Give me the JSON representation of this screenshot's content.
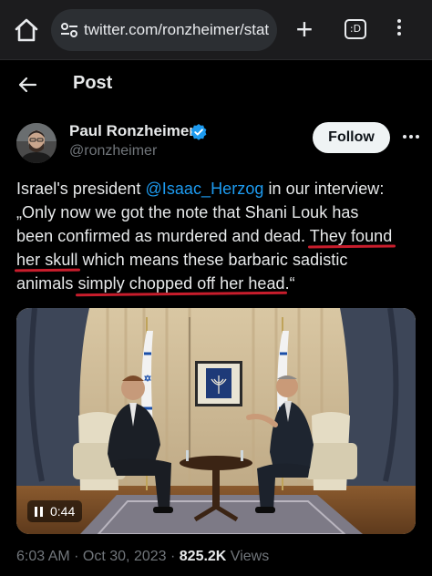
{
  "browser": {
    "url": "twitter.com/ronzheimer/status",
    "tab_count": ":D",
    "icons": [
      "home-icon",
      "site-settings-icon",
      "new-tab-icon",
      "tab-switcher-icon",
      "menu-icon"
    ]
  },
  "header": {
    "title": "Post",
    "back_icon": "arrow-left-icon"
  },
  "author": {
    "name": "Paul Ronzheimer",
    "handle": "@ronzheimer",
    "verified_color": "#1d9bf0",
    "follow_label": "Follow"
  },
  "tweet": {
    "l1_pre": "Israel's president ",
    "l1_mention": "@Isaac_Herzog",
    "l1_post": " in our interview:",
    "l2": "„Only now we got the note that Shani Louk has",
    "l3_pre": "been confirmed as murdered and dead. ",
    "l3_ul": "They found",
    "l4_ul": "her skull",
    "l4_post": " which means these barbaric sadistic",
    "l5_pre": "animals ",
    "l5_ul": "simply chopped off her head",
    "l5_post": ".“",
    "underline_color": "#c81d2c",
    "mention_color": "#1d9bf0"
  },
  "video": {
    "time": "0:44",
    "state_icon": "pause-icon"
  },
  "meta": {
    "time": "6:03 AM",
    "sep1": " · ",
    "date": "Oct 30, 2023",
    "sep2": " · ",
    "views_count": "825.2K",
    "views_label": " Views"
  }
}
